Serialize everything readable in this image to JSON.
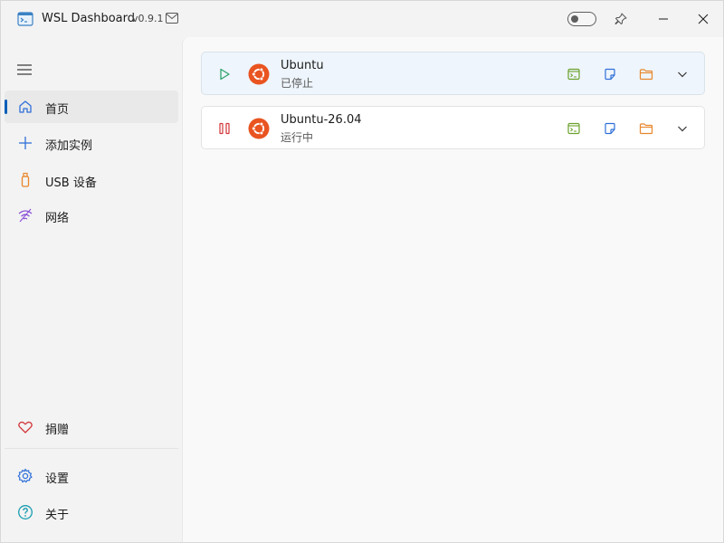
{
  "window": {
    "title": "WSL Dashboard",
    "version": "v0.9.1"
  },
  "sidebar": {
    "items": [
      {
        "label": "首页",
        "icon": "home-icon",
        "active": true
      },
      {
        "label": "添加实例",
        "icon": "plus-icon"
      },
      {
        "label": "USB 设备",
        "icon": "usb-icon"
      },
      {
        "label": "网络",
        "icon": "network-icon"
      }
    ],
    "footer": [
      {
        "label": "捐赠",
        "icon": "heart-icon"
      },
      {
        "label": "设置",
        "icon": "gear-icon"
      },
      {
        "label": "关于",
        "icon": "help-icon"
      }
    ]
  },
  "instances": [
    {
      "name": "Ubuntu",
      "status": "已停止",
      "state": "stopped"
    },
    {
      "name": "Ubuntu-26.04",
      "status": "运行中",
      "state": "running"
    }
  ],
  "colors": {
    "accent": "#005fb8",
    "ubuntu": "#e95420",
    "play": "#2fa36b",
    "stop": "#d13438",
    "terminal": "#6ba12b",
    "note": "#2f6fd8",
    "folder": "#e8862b"
  }
}
